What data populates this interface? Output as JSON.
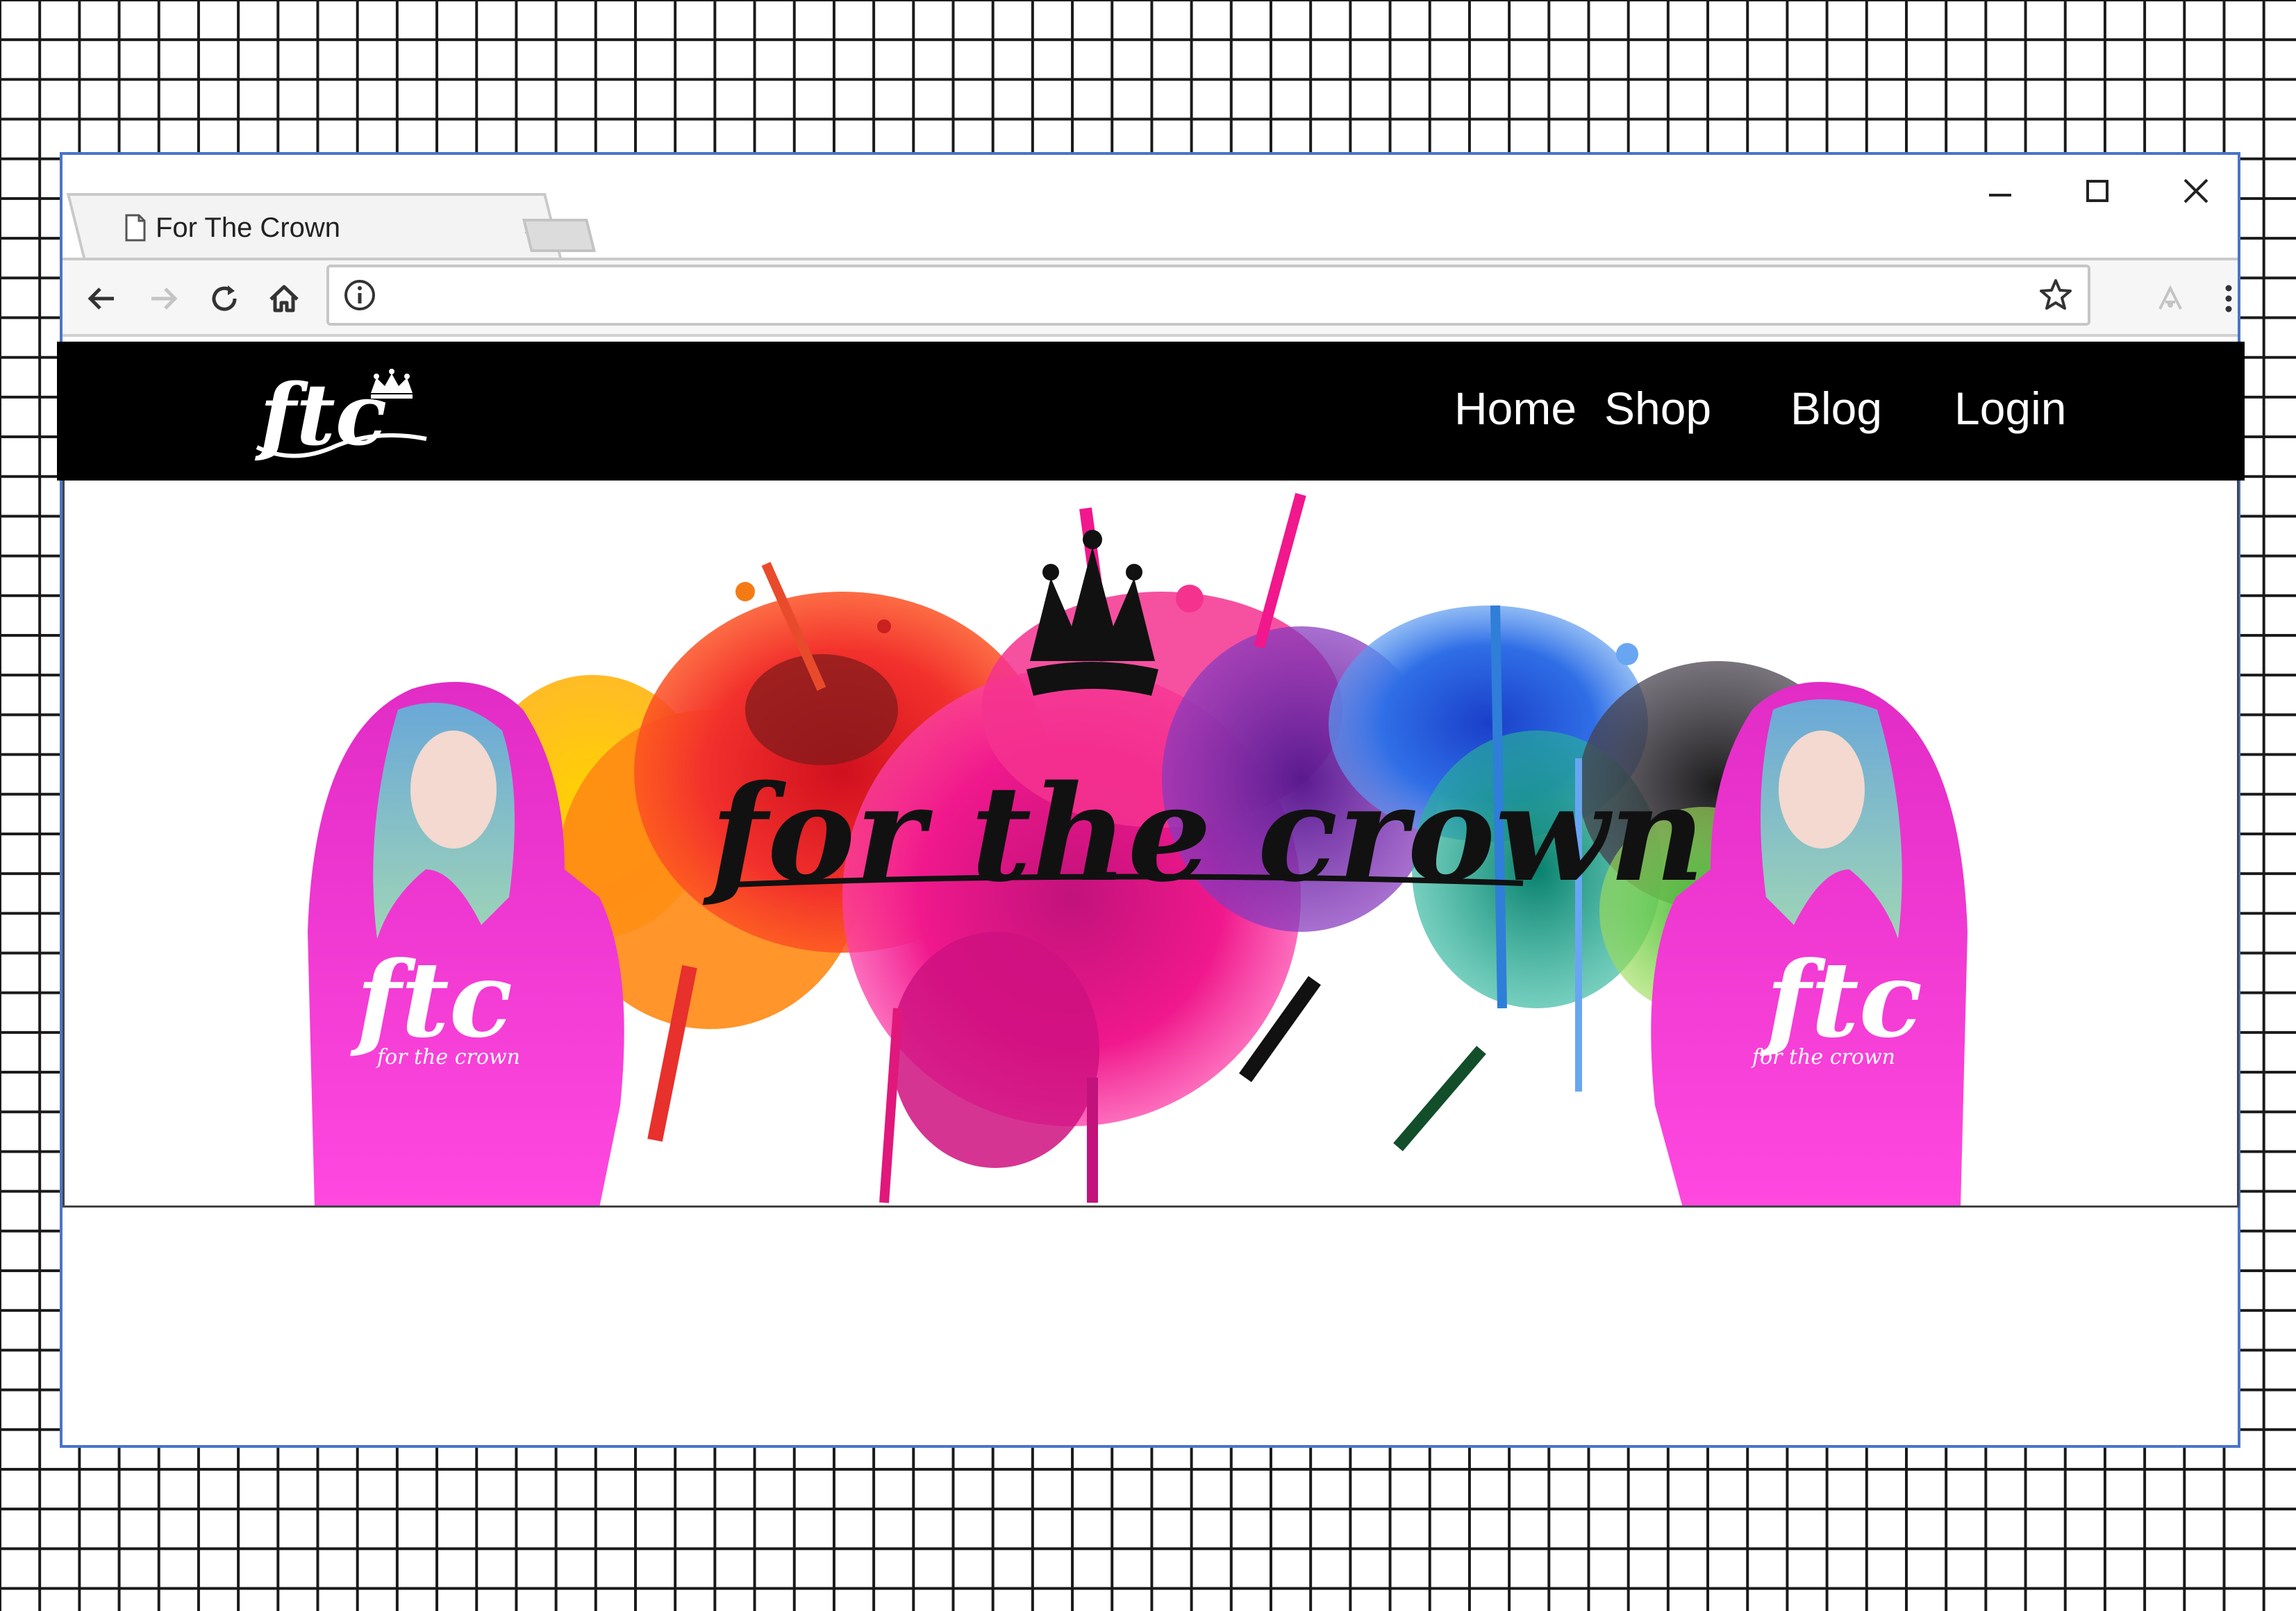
{
  "browser": {
    "tab_title": "For The Crown",
    "address_value": "",
    "icons": [
      "page-icon",
      "close-icon",
      "new-tab",
      "minimize-icon",
      "maximize-icon",
      "window-close-icon",
      "back-arrow-icon",
      "forward-arrow-icon",
      "reload-icon",
      "home-icon",
      "info-icon",
      "star-icon",
      "extension-icon",
      "menu-dots-icon"
    ]
  },
  "site": {
    "logo_text": "ftc",
    "nav": [
      {
        "label": "Home"
      },
      {
        "label": "Shop"
      },
      {
        "label": "Blog"
      },
      {
        "label": "Login"
      }
    ],
    "hero": {
      "wordmark": "for the crown",
      "shirt_logo": "ftc",
      "shirt_text": "for the crown"
    }
  },
  "colors": {
    "navbar": "#000000",
    "window_border": "#4a74c9",
    "hoodie": "#f43ad6"
  }
}
